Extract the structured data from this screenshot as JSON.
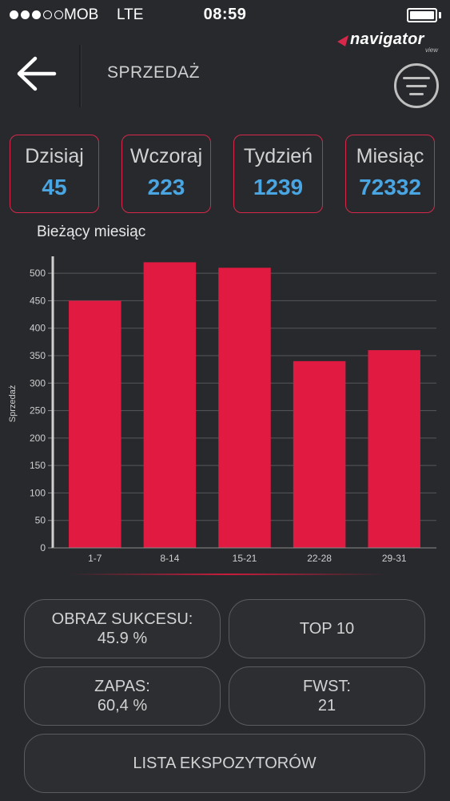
{
  "status_bar": {
    "carrier": "MOB",
    "network": "LTE",
    "time": "08:59",
    "signal_bars": 3,
    "signal_total": 5
  },
  "brand": {
    "name": "navigator",
    "sub": "view",
    "accent": "#d6284a"
  },
  "header": {
    "title": "SPRZEDAŻ"
  },
  "stats": [
    {
      "label": "Dzisiaj",
      "value": "45"
    },
    {
      "label": "Wczoraj",
      "value": "223"
    },
    {
      "label": "Tydzień",
      "value": "1239"
    },
    {
      "label": "Miesiąc",
      "value": "72332"
    }
  ],
  "chart_title": "Bieżący miesiąc",
  "chart_data": {
    "type": "bar",
    "categories": [
      "1-7",
      "8-14",
      "15-21",
      "22-28",
      "29-31"
    ],
    "values": [
      450,
      520,
      510,
      340,
      360
    ],
    "ylabel": "Sprzedaż",
    "ylim": [
      0,
      525
    ],
    "yticks": [
      0,
      50,
      100,
      150,
      200,
      250,
      300,
      350,
      400,
      450,
      500
    ],
    "grid": true,
    "bar_color": "#e01a40"
  },
  "buttons": {
    "success": {
      "label": "OBRAZ SUKCESU:",
      "value": "45.9 %"
    },
    "top10": {
      "label": "TOP 10"
    },
    "stock": {
      "label": "ZAPAS:",
      "value": "60,4 %"
    },
    "fwst": {
      "label": "FWST:",
      "value": "21"
    },
    "exhibitors": {
      "label": "LISTA EKSPOZYTORÓW"
    }
  }
}
